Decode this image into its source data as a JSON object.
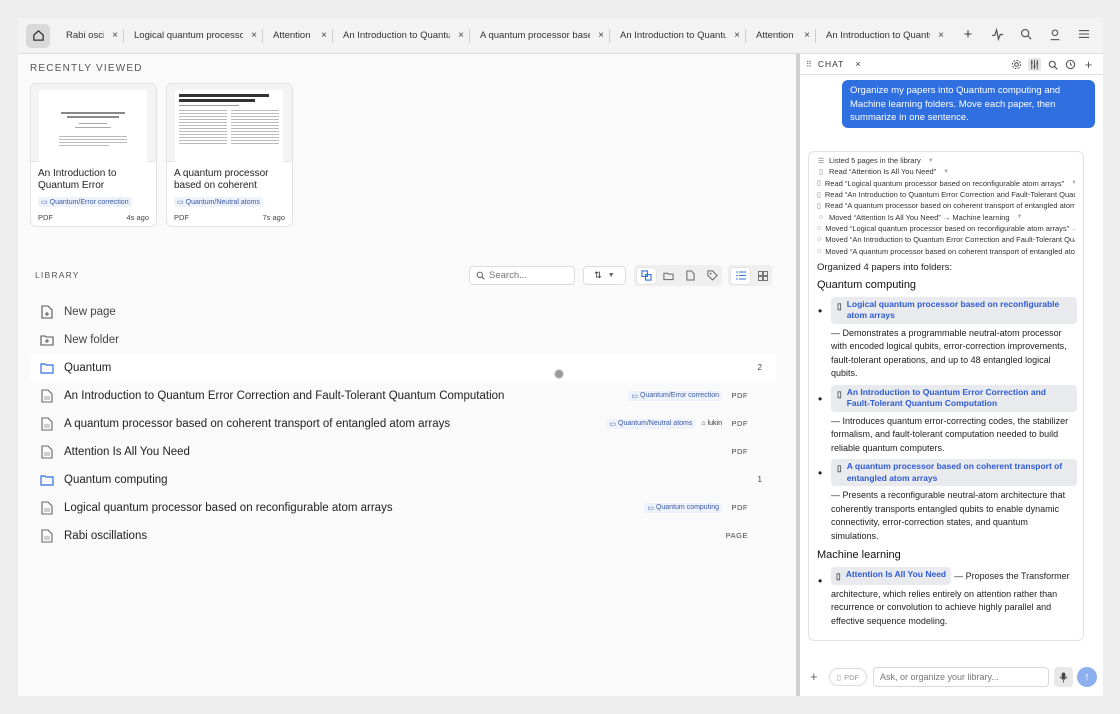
{
  "tabs": [
    {
      "title": "Rabi oscillations",
      "width": 68
    },
    {
      "title": "Logical quantum processor based on reconfigurable atom arrays",
      "width": 139
    },
    {
      "title": "Attention Is All You Need",
      "width": 70
    },
    {
      "title": "An Introduction to Quantum Error Correction and Fault-Tolerant Quantum Computation",
      "width": 137
    },
    {
      "title": "A quantum processor based on coherent transport of entangled atom arrays",
      "width": 140
    },
    {
      "title": "An Introduction to Quantum Error Correction and Fault-Tolerant Quantum Computation",
      "width": 136
    },
    {
      "title": "Attention Is All You Need",
      "width": 70
    },
    {
      "title": "An Introduction to Quantum Error Correction and Fault-Tolerant Quantum Computation",
      "width": 134
    }
  ],
  "toolbar": {
    "new_tab": "+",
    "icons": [
      "activity-icon",
      "search-icon",
      "user-icon",
      "menu-icon"
    ]
  },
  "recently_viewed": {
    "title": "RECENTLY VIEWED",
    "cards": [
      {
        "title": "An Introduction to Quantum Error Correction and Fault-Tolerant Quantum Computation",
        "chip": "Quantum/Error correction",
        "type": "PDF",
        "age": "4s ago"
      },
      {
        "title": "A quantum processor based on coherent transport of entangled atom arrays",
        "chip": "Quantum/Neutral atoms",
        "type": "PDF",
        "age": "7s ago"
      }
    ]
  },
  "library": {
    "title": "LIBRARY",
    "search_placeholder": "Search...",
    "rows": [
      {
        "kind": "page",
        "label": "New page"
      },
      {
        "kind": "folder-new",
        "label": "New folder"
      },
      {
        "kind": "folder",
        "label": "Quantum",
        "count": "2"
      },
      {
        "kind": "doc",
        "label": "An Introduction to Quantum Error Correction and Fault-Tolerant Quantum Computation",
        "chips": [
          "Quantum/Error correction"
        ],
        "tags": [],
        "type": "PDF"
      },
      {
        "kind": "doc",
        "label": "A quantum processor based on coherent transport of entangled atom arrays",
        "chips": [
          "Quantum/Neutral atoms"
        ],
        "tags": [
          "lukin"
        ],
        "type": "PDF"
      },
      {
        "kind": "doc",
        "label": "Attention Is All You Need",
        "chips": [],
        "tags": [],
        "type": "PDF"
      },
      {
        "kind": "folder",
        "label": "Quantum computing",
        "count": "1"
      },
      {
        "kind": "doc",
        "label": "Logical quantum processor based on reconfigurable atom arrays",
        "chips": [
          "Quantum computing"
        ],
        "tags": [],
        "type": "PDF"
      },
      {
        "kind": "doc",
        "label": "Rabi oscillations",
        "chips": [],
        "tags": [],
        "type": "PAGE"
      }
    ]
  },
  "chat": {
    "tab_label": "CHAT",
    "user_message": "Organize my papers into Quantum computing and Machine learning folders. Move each paper, then summarize in one sentence.",
    "actions": [
      {
        "icon": "list",
        "text": "Listed 5 pages in the library"
      },
      {
        "icon": "read",
        "text": "Read “Attention Is All You Need”"
      },
      {
        "icon": "read",
        "text": "Read “Logical quantum processor based on reconfigurable atom arrays”"
      },
      {
        "icon": "read",
        "text": "Read “An Introduction to Quantum Error Correction and Fault-Tolerant Quantum Computation”"
      },
      {
        "icon": "read",
        "text": "Read “A quantum processor based on coherent transport of entangled atom arrays”"
      },
      {
        "icon": "move",
        "text": "Moved “Attention Is All You Need” → Machine learning"
      },
      {
        "icon": "move",
        "text": "Moved “Logical quantum processor based on reconfigurable atom arrays” → Quantum computing"
      },
      {
        "icon": "move",
        "text": "Moved “An Introduction to Quantum Error Correction and Fault-Tolerant Quantum Computation” → Quantum computing"
      },
      {
        "icon": "move",
        "text": "Moved “A quantum processor based on coherent transport of entangled atom arrays” → Quantum computing"
      }
    ],
    "organized_text": "Organized 4 papers into folders:",
    "sections": [
      {
        "heading": "Quantum computing",
        "items": [
          {
            "ref": "Logical quantum processor based on reconfigurable atom arrays",
            "summary": "— Demonstrates a programmable neutral-atom processor with encoded logical qubits, error-correction improvements, fault-tolerant operations, and up to 48 entangled logical qubits."
          },
          {
            "ref": "An Introduction to Quantum Error Correction and Fault-Tolerant Quantum Computation",
            "summary": "— Introduces quantum error-correcting codes, the stabilizer formalism, and fault-tolerant computation needed to build reliable quantum computers."
          },
          {
            "ref": "A quantum processor based on coherent transport of entangled atom arrays",
            "summary": "— Presents a reconfigurable neutral-atom architecture that coherently transports entangled qubits to enable dynamic connectivity, error-correction states, and quantum simulations."
          }
        ]
      },
      {
        "heading": "Machine learning",
        "items": [
          {
            "ref": "Attention Is All You Need",
            "summary": "— Proposes the Transformer architecture, which relies entirely on attention rather than recurrence or convolution to achieve highly parallel and effective sequence modeling."
          }
        ]
      }
    ],
    "input_placeholder": "Ask, or organize your library...",
    "attach_label": "PDF"
  },
  "colors": {
    "accent": "#2f6fe0",
    "chip_bg": "#eef2fb",
    "chip_text": "#3b5aa8"
  }
}
